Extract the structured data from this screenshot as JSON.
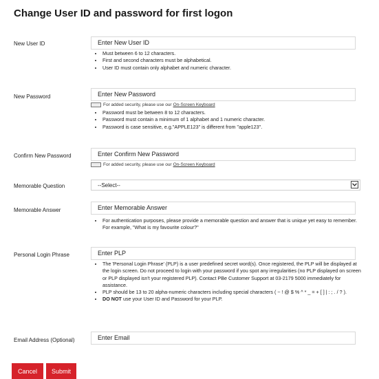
{
  "page": {
    "title": "Change User ID and password for first logon"
  },
  "fields": {
    "user_id": {
      "label": "New User ID",
      "placeholder": "Enter New User ID",
      "rules": [
        "Must between 6 to 12 characters.",
        "First and second characters must be alphabetical.",
        "User ID must contain only alphabet and numeric character."
      ]
    },
    "password": {
      "label": "New Password",
      "placeholder": "Enter New Password",
      "keyboard_note": "For added security, please use our",
      "keyboard_link": "On-Screen Keyboard",
      "rules": [
        "Password must be between 8 to 12 characters.",
        "Password must contain a minimum of 1 alphabet and 1 numeric character.",
        "Password is case sensitive, e.g.\"APPLE123\" is different from \"apple123\"."
      ]
    },
    "confirm_password": {
      "label": "Confirm New Password",
      "placeholder": "Enter Confirm New Password",
      "keyboard_note": "For added security, please use our",
      "keyboard_link": "On-Screen Keyboard"
    },
    "memorable_question": {
      "label": "Memorable Question",
      "selected": "--Select--",
      "icon": "chevron-down-icon"
    },
    "memorable_answer": {
      "label": "Memorable Answer",
      "placeholder": "Enter Memorable Answer",
      "rules": [
        "For authentication purposes, please provide a memorable question and answer that is unique yet easy to remember. For example, \"What is my favourite colour?\""
      ]
    },
    "plp": {
      "label": "Personal Login Phrase",
      "placeholder": "Enter PLP",
      "rules": [
        "The 'Personal Login Phrase' (PLP) is a user predefined secret word(s). Once registered, the PLP will be displayed at the login screen. Do not proceed to login with your password if you spot any irregularities (no PLP displayed on screen or PLP displayed isn't your registered PLP). Contact PBe Customer Support at 03-2179 5000 immediately for assistance.",
        "PLP should be 13 to 20 alpha-numeric characters including special characters ( ~ ! @ $ % ^ * _ = + [ ] | : ; . / ? )."
      ],
      "last_rule_bold": "DO NOT",
      "last_rule_rest": " use your User ID and Password for your PLP."
    },
    "email": {
      "label": "Email Address (Optional)",
      "placeholder": "Enter Email"
    }
  },
  "buttons": {
    "cancel": "Cancel",
    "submit": "Submit"
  },
  "colors": {
    "button_bg": "#d6222a",
    "button_text": "#ffffff"
  }
}
